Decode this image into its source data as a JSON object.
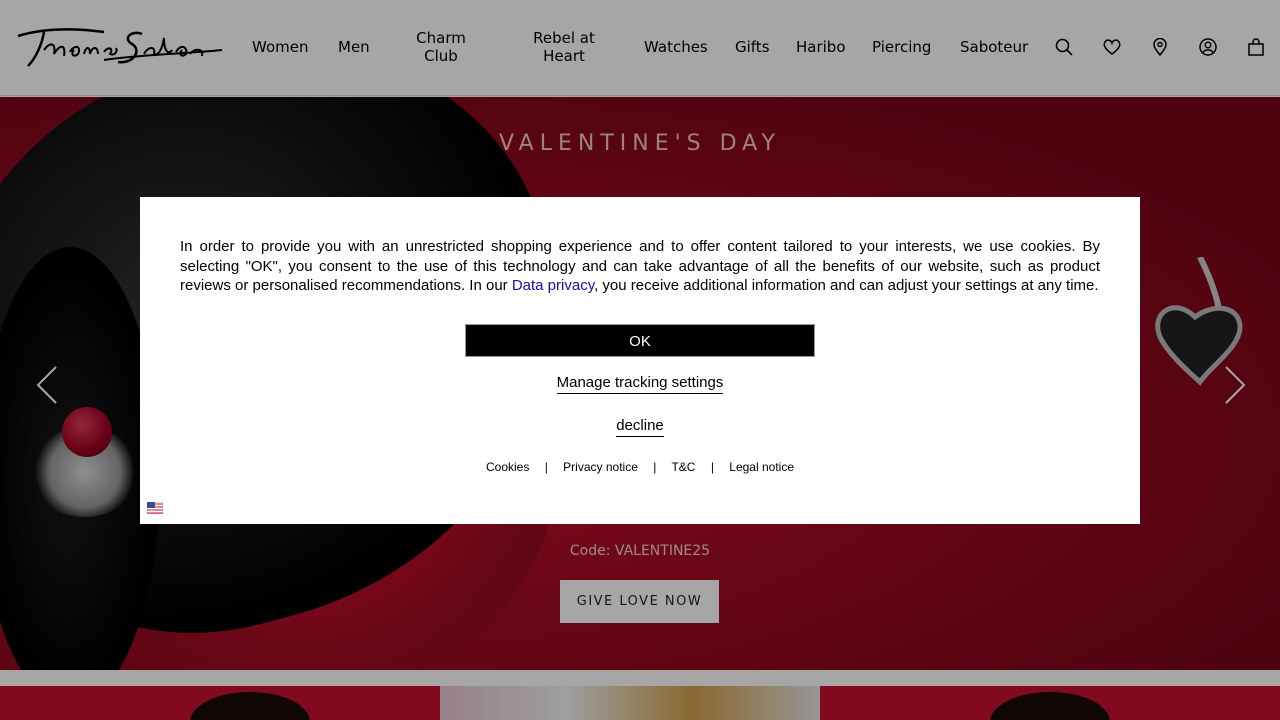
{
  "header": {
    "logo_text": "Thomas Sabo",
    "nav": [
      {
        "label": "Women"
      },
      {
        "label": "Men"
      },
      {
        "label": "Charm Club"
      },
      {
        "label": "Rebel at Heart"
      },
      {
        "label": "Watches"
      },
      {
        "label": "Gifts"
      },
      {
        "label": "Haribo"
      },
      {
        "label": "Piercing"
      },
      {
        "label": "Saboteur"
      }
    ],
    "icons": [
      "search-icon",
      "heart-icon",
      "location-pin-icon",
      "account-icon",
      "bag-icon"
    ]
  },
  "hero": {
    "title": "VALENTINE'S DAY",
    "code": "Code: VALENTINE25",
    "cta": "GIVE LOVE NOW"
  },
  "cookie_modal": {
    "text_before": "In order to provide you with an unrestricted shopping experience and to offer content tailored to your interests, we use cookies. By selecting \"OK\", you consent to the use of this technology and can take advantage of all the benefits of our website, such as product reviews or personalised recommendations. In our ",
    "link_text": "Data privacy",
    "text_after": ", you receive additional information and can adjust your settings at any time.",
    "ok_label": "OK",
    "manage_label": "Manage tracking settings",
    "decline_label": "decline",
    "footer_links": [
      "Cookies",
      "Privacy notice",
      "T&C",
      "Legal notice"
    ],
    "separator": "|"
  },
  "colors": {
    "accent_red": "#c8102e",
    "overlay": "rgba(0,0,0,0.35)",
    "link_blue": "#1a0dab"
  }
}
